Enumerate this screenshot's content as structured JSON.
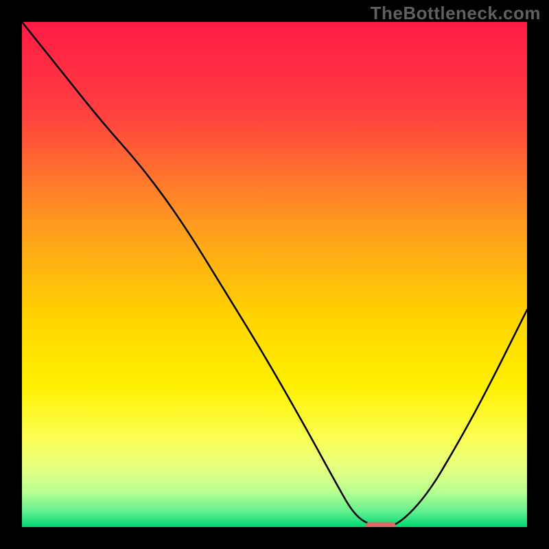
{
  "watermark": "TheBottleneck.com",
  "chart_data": {
    "type": "line",
    "title": "",
    "xlabel": "",
    "ylabel": "",
    "xlim": [
      0,
      100
    ],
    "ylim": [
      0,
      100
    ],
    "grid": false,
    "legend": false,
    "series": [
      {
        "name": "curve",
        "x": [
          0,
          8,
          16,
          24,
          32,
          40,
          48,
          56,
          62,
          66,
          70,
          74,
          80,
          86,
          92,
          100
        ],
        "y": [
          100,
          90,
          80,
          71,
          60,
          47,
          34,
          20,
          9,
          2,
          0,
          0,
          6,
          16,
          27,
          43
        ]
      }
    ],
    "marker": {
      "name": "optimal-marker",
      "x": 71,
      "y": 0,
      "width": 6,
      "height": 2,
      "color": "#d96a6a"
    },
    "background_gradient": {
      "stops": [
        {
          "offset": 0.0,
          "color": "#ff1a45"
        },
        {
          "offset": 0.18,
          "color": "#ff4040"
        },
        {
          "offset": 0.4,
          "color": "#ff9a20"
        },
        {
          "offset": 0.58,
          "color": "#ffd300"
        },
        {
          "offset": 0.72,
          "color": "#fff000"
        },
        {
          "offset": 0.82,
          "color": "#faff50"
        },
        {
          "offset": 0.88,
          "color": "#e8ff80"
        },
        {
          "offset": 0.93,
          "color": "#b8ff90"
        },
        {
          "offset": 0.97,
          "color": "#60f090"
        },
        {
          "offset": 1.0,
          "color": "#00d870"
        }
      ]
    }
  }
}
